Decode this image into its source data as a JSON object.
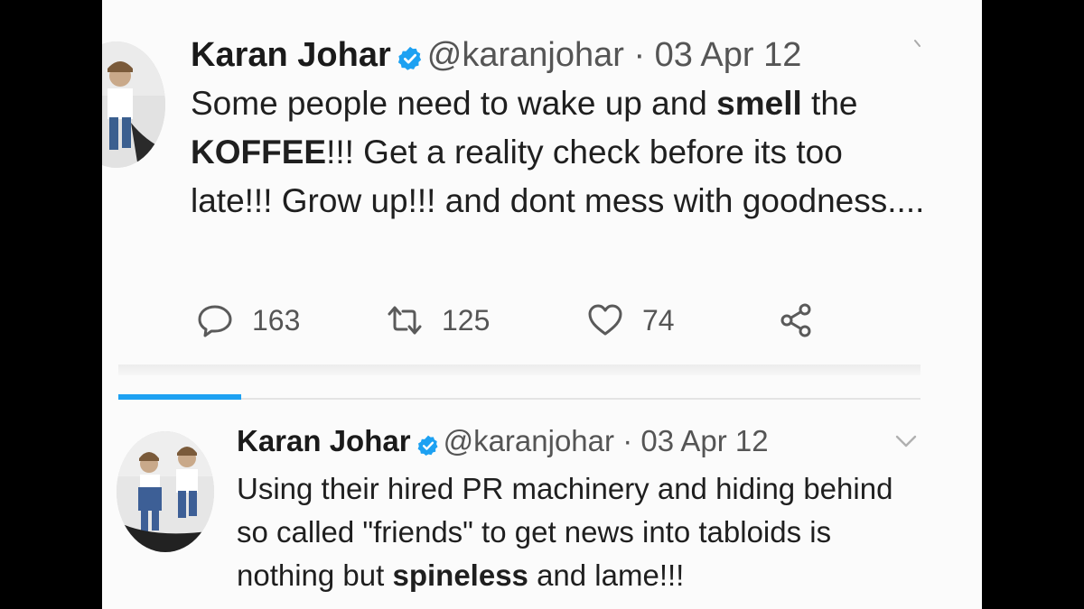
{
  "tweets": [
    {
      "name": "Karan Johar",
      "handle": "@karanjohar",
      "separator": "·",
      "date": "03 Apr 12",
      "body": {
        "t1": "Some people need to wake up and ",
        "b1": "smell",
        "t2": " the ",
        "b2": "KOFFEE",
        "t3": "!!! Get a reality check before its too late!!! Grow up!!! and dont mess with goodness...."
      },
      "actions": {
        "reply_count": "163",
        "retweet_count": "125",
        "like_count": "74"
      }
    },
    {
      "name": "Karan Johar",
      "handle": "@karanjohar",
      "separator": "·",
      "date": "03 Apr 12",
      "body": {
        "t1": "Using their hired PR machinery and hiding behind so called \"friends\" to get news into tabloids is nothing but ",
        "b1": "spineless",
        "t2": " and lame!!!"
      }
    }
  ],
  "colors": {
    "accent": "#1da1f2",
    "verified_badge": "#1da1f2",
    "background": "#fbfbfb",
    "text": "#1f1f1f",
    "muted": "#555555"
  },
  "icons": [
    "verified-badge-icon",
    "chevron-down-icon",
    "reply-icon",
    "retweet-icon",
    "like-icon",
    "share-icon"
  ]
}
